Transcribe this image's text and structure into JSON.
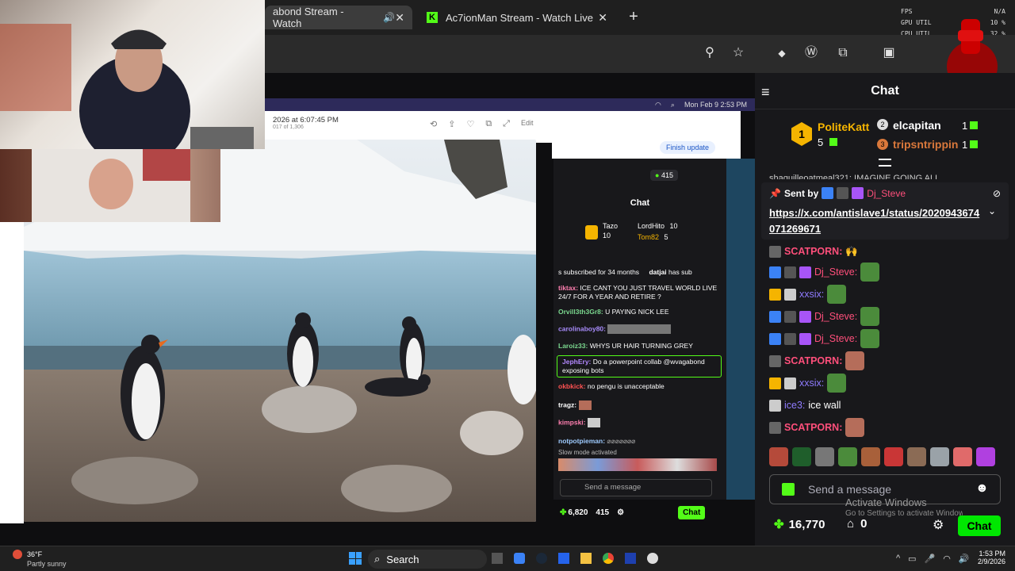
{
  "tabs": [
    {
      "label": "abond Stream - Watch"
    },
    {
      "label": "Ac7ionMan Stream - Watch Live"
    }
  ],
  "perf": {
    "rows": [
      {
        "label": "FPS",
        "value": "N/A"
      },
      {
        "label": "GPU UTIL",
        "value": "10 %"
      },
      {
        "label": "CPU UTIL",
        "value": "32 %"
      }
    ]
  },
  "mac_status": {
    "date": "Mon Feb 9  2:53 PM"
  },
  "tweet": {
    "timestamp": "2026 at 6:07:45 PM",
    "sub": "017 of 1,306",
    "edit": "Edit"
  },
  "inner_browser": {
    "update_button": "Finish update"
  },
  "inner_chat": {
    "viewers": "415",
    "header": "Chat",
    "top_gifters": [
      {
        "name": "Tazo",
        "count": "10"
      },
      {
        "name": "LordHito",
        "count": "10"
      },
      {
        "name": "Tom82",
        "count": "5"
      }
    ],
    "sub_banner": "s subscribed for 34 months",
    "sub_banner_user": "datjai",
    "sub_banner_tail": "has sub",
    "messages": [
      {
        "user": "tiktax:",
        "text": "ICE CANT YOU JUST TRAVEL WORLD LIVE 24/7 FOR A YEAR AND RETIRE ?",
        "color": "#ff7fb0"
      },
      {
        "user": "Orvill3th3Gr8:",
        "text": "U PAYING NICK LEE",
        "color": "#7bd88f"
      },
      {
        "user": "carolinaboy80:",
        "text": "",
        "color": "#a78bfa"
      },
      {
        "user": "Laroiz33:",
        "text": "WHYS UR HAIR TURNING GREY",
        "color": "#7bd88f"
      },
      {
        "user": "JephEry:",
        "text": "Do a powerpoint collab @wvagabond exposing bots",
        "color": "#b388ff"
      },
      {
        "user": "okbkick:",
        "text": "no pengu is unacceptable",
        "color": "#ff5252"
      },
      {
        "user": "tragz:",
        "text": "",
        "color": "#ffffff"
      },
      {
        "user": "kimpski:",
        "text": "",
        "color": "#ff7fb0"
      },
      {
        "user": "notpotpieman:",
        "text": "",
        "color": "#9ecbff"
      }
    ],
    "slow_mode": "Slow mode activated",
    "input_placeholder": "Send a message",
    "points": "6,820",
    "viewer_count": "415",
    "chat_button": "Chat"
  },
  "chat": {
    "title": "Chat",
    "leaderboard": {
      "first": {
        "rank": "1",
        "name": "PoliteKatt",
        "count": "5"
      },
      "second": {
        "rank": "2",
        "name": "elcapitan",
        "count": "1"
      },
      "third": {
        "rank": "3",
        "name": "tripsntrippin",
        "count": "1"
      }
    },
    "cut_line": "shaquilleoatmeal321: IMAGINE GOING ALL",
    "pinned": {
      "label": "Sent by",
      "user": "Dj_Steve",
      "link": "https://x.com/antislave1/status/2020943674071269671"
    },
    "messages": [
      {
        "user": "SCATPORN:",
        "text": "",
        "color": "#ff4f7b"
      },
      {
        "user": "Dj_Steve:",
        "text": "",
        "color": "#ff4f7b"
      },
      {
        "user": "xxsix:",
        "text": "",
        "color": "#8f7bff"
      },
      {
        "user": "Dj_Steve:",
        "text": "",
        "color": "#ff4f7b"
      },
      {
        "user": "Dj_Steve:",
        "text": "",
        "color": "#ff4f7b"
      },
      {
        "user": "SCATPORN:",
        "text": "",
        "color": "#ff4f7b"
      },
      {
        "user": "xxsix:",
        "text": "",
        "color": "#8f7bff"
      },
      {
        "user": "ice3:",
        "text": "ice wall",
        "color": "#8f7bff"
      },
      {
        "user": "SCATPORN:",
        "text": "",
        "color": "#ff4f7b"
      }
    ],
    "input_placeholder": "Send a message",
    "points": "16,770",
    "count": "0",
    "chat_button": "Chat",
    "watermark_1": "Activate Windows",
    "watermark_2": "Go to Settings to activate Windows."
  },
  "taskbar": {
    "temp": "36°F",
    "weather": "Partly sunny",
    "search": "Search",
    "time": "1:53 PM",
    "date": "2/9/2026"
  },
  "colors": {
    "accent_green": "#00e701",
    "kick_green": "#53fc18",
    "chat_bg": "#18181b"
  }
}
